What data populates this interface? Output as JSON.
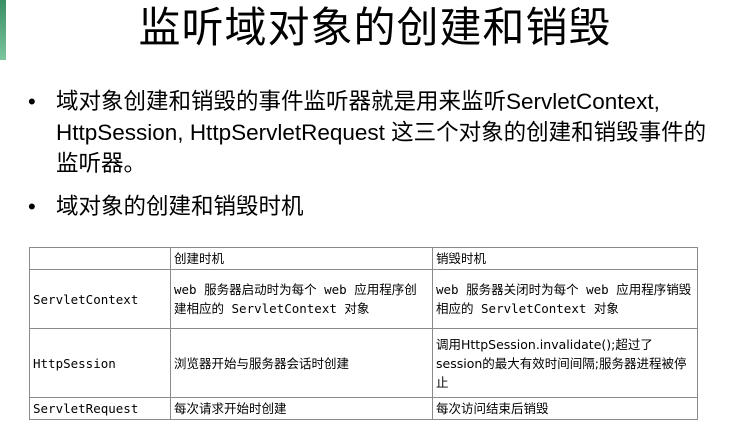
{
  "title": "监听域对象的创建和销毁",
  "bullets": [
    "域对象创建和销毁的事件监听器就是用来监听ServletContext, HttpSession, HttpServletRequest 这三个对象的创建和销毁事件的监听器。",
    "域对象的创建和销毁时机"
  ],
  "bullet_symbol": "•",
  "accent_color": "#3a8f63",
  "table": {
    "headers": [
      "",
      "创建时机",
      "销毁时机"
    ],
    "rows": [
      {
        "name": "ServletContext",
        "create": "web 服务器启动时为每个 web 应用程序创建相应的 ServletContext 对象",
        "destroy": "web 服务器关闭时为每个 web 应用程序销毁相应的 ServletContext 对象"
      },
      {
        "name": "HttpSession",
        "create": "浏览器开始与服务器会话时创建",
        "destroy": "调用HttpSession.invalidate();超过了session的最大有效时间间隔;服务器进程被停止"
      },
      {
        "name": "ServletRequest",
        "create": "每次请求开始时创建",
        "destroy": "每次访问结束后销毁"
      }
    ]
  }
}
